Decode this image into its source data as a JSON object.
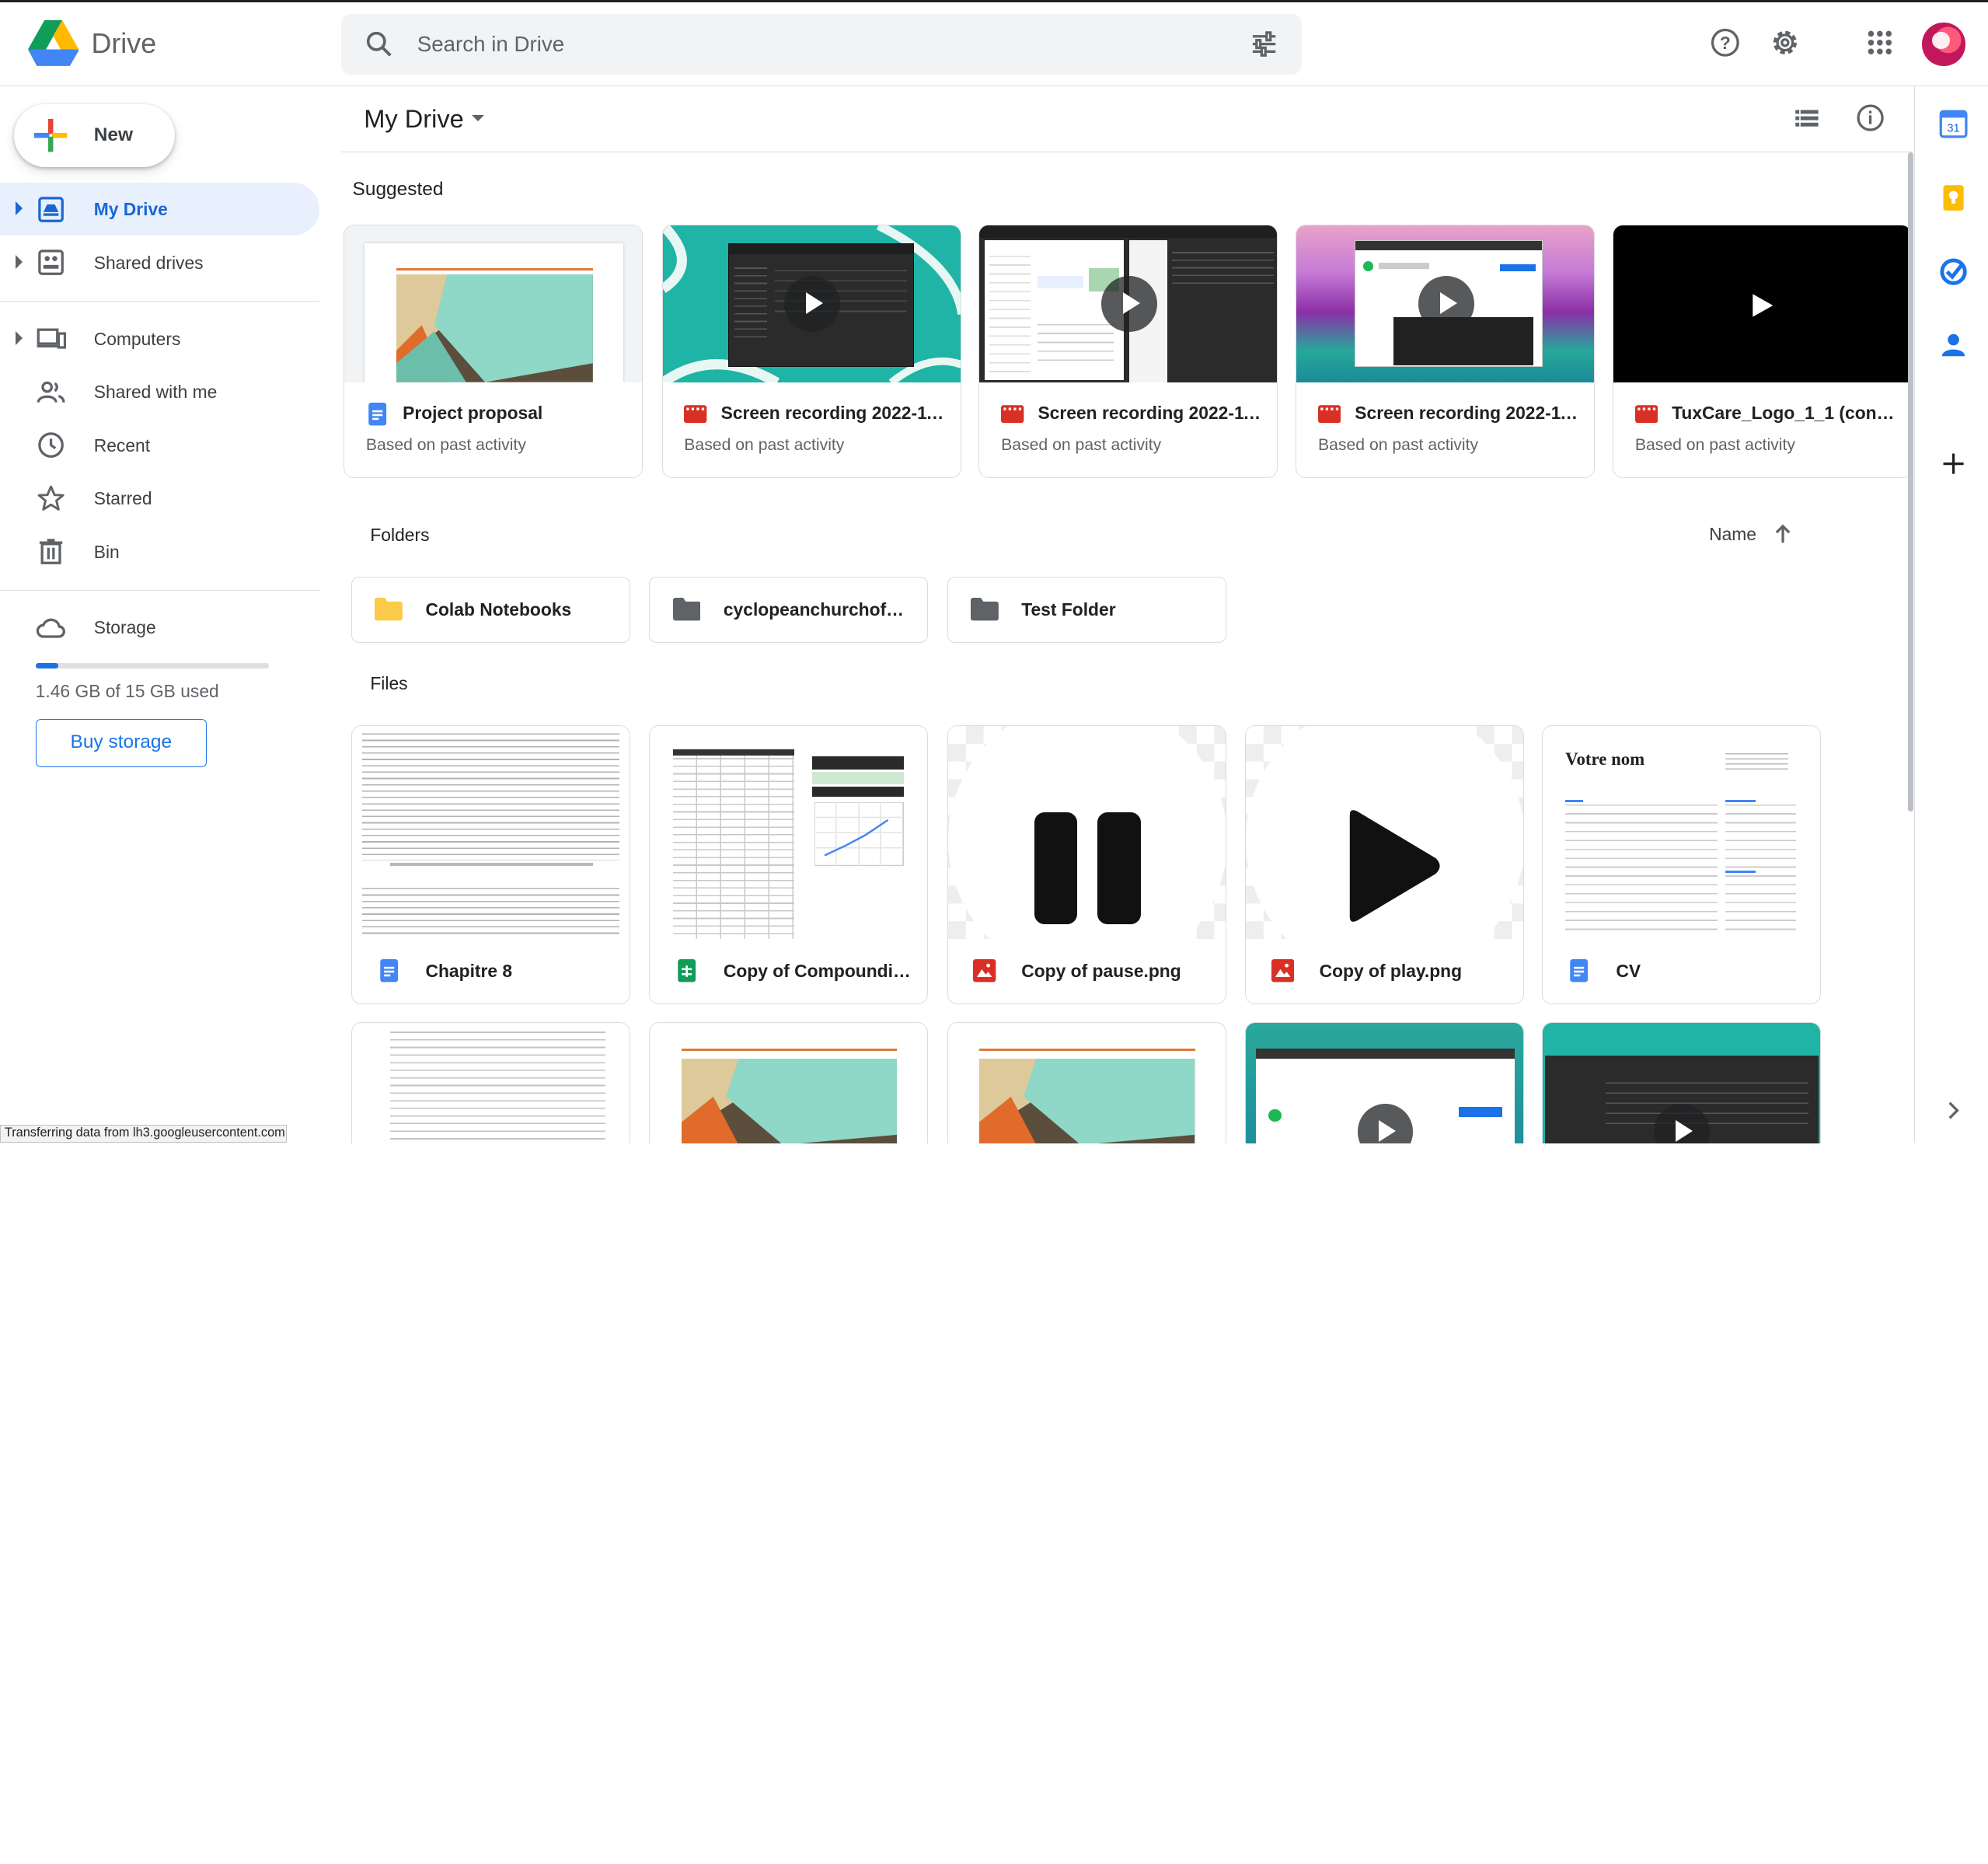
{
  "app": {
    "title": "Drive"
  },
  "search": {
    "placeholder": "Search in Drive"
  },
  "sidebar": {
    "new_label": "New",
    "items": [
      {
        "label": "My Drive",
        "icon": "my-drive-icon",
        "active": true
      },
      {
        "label": "Shared drives",
        "icon": "shared-drives-icon"
      },
      {
        "label": "Computers",
        "icon": "computers-icon"
      },
      {
        "label": "Shared with me",
        "icon": "shared-with-me-icon"
      },
      {
        "label": "Recent",
        "icon": "clock-icon"
      },
      {
        "label": "Starred",
        "icon": "star-icon"
      },
      {
        "label": "Bin",
        "icon": "trash-icon"
      }
    ],
    "storage": {
      "label": "Storage",
      "used_text": "1.46 GB of 15 GB used",
      "used_fraction": 0.097,
      "buy_label": "Buy storage"
    }
  },
  "main": {
    "title": "My Drive",
    "suggested_title": "Suggested",
    "suggested": [
      {
        "name": "Project proposal",
        "sub": "Based on past activity",
        "type": "docs"
      },
      {
        "name": "Screen recording 2022-11...",
        "sub": "Based on past activity",
        "type": "video"
      },
      {
        "name": "Screen recording 2022-11...",
        "sub": "Based on past activity",
        "type": "video"
      },
      {
        "name": "Screen recording 2022-11...",
        "sub": "Based on past activity",
        "type": "video"
      },
      {
        "name": "TuxCare_Logo_1_1 (conve...",
        "sub": "Based on past activity",
        "type": "video"
      }
    ],
    "folders_title": "Folders",
    "sort_label": "Name",
    "folders": [
      {
        "name": "Colab Notebooks",
        "color": "#f9cb48"
      },
      {
        "name": "cyclopeanchurchofpol...",
        "color": "#5f6368"
      },
      {
        "name": "Test Folder",
        "color": "#5f6368"
      }
    ],
    "files_title": "Files",
    "files": [
      {
        "name": "Chapitre 8",
        "type": "docs"
      },
      {
        "name": "Copy of Compounding...",
        "type": "sheets"
      },
      {
        "name": "Copy of pause.png",
        "type": "image"
      },
      {
        "name": "Copy of play.png",
        "type": "image"
      },
      {
        "name": "CV",
        "type": "docs"
      }
    ],
    "cv_heading": "Votre nom"
  },
  "status_text": "Transferring data from lh3.googleusercontent.com...",
  "colors": {
    "accent": "#1a73e8",
    "active_bg": "#e8f0fe",
    "docs": "#4285f4",
    "sheets": "#0f9d58",
    "video": "#d93025"
  },
  "rail": {
    "calendar_date": "31"
  }
}
